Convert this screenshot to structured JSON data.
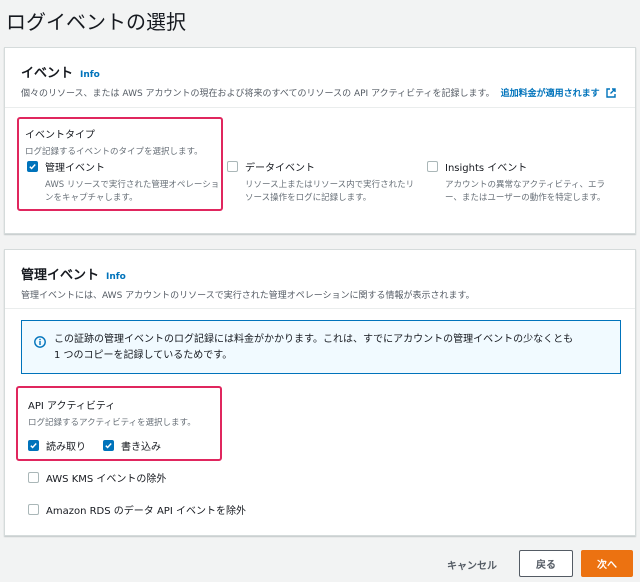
{
  "page": {
    "title": "ログイベントの選択"
  },
  "events_panel": {
    "title": "イベント",
    "info": "Info",
    "description": "個々のリソース、または AWS アカウントの現在および将来のすべてのリソースの API アクティビティを記録します。",
    "extra_charge_link": "追加料金が適用されます",
    "event_type": {
      "label": "イベントタイプ",
      "sublabel": "ログ記録するイベントのタイプを選択します。",
      "options": [
        {
          "label": "管理イベント",
          "checked": true,
          "desc_line1": "AWS リソースで実行された管理オペレーショ",
          "desc_line2": "ンをキャプチャします。"
        },
        {
          "label": "データイベント",
          "checked": false,
          "desc_line1": "リソース上またはリソース内で実行されたリ",
          "desc_line2": "ソース操作をログに記録します。"
        },
        {
          "label": "Insights イベント",
          "checked": false,
          "desc_line1": "アカウントの異常なアクティビティ、エラ",
          "desc_line2": "ー、またはユーザーの動作を特定します。"
        }
      ]
    }
  },
  "mgmt_panel": {
    "title": "管理イベント",
    "info": "Info",
    "description": "管理イベントには、AWS アカウントのリソースで実行された管理オペレーションに関する情報が表示されます。",
    "alert_line1": "この証跡の管理イベントのログ記録には料金がかかります。これは、すでにアカウントの管理イベントの少なくとも",
    "alert_line2": "1 つのコピーを記録しているためです。",
    "api_activity": {
      "label": "API アクティビティ",
      "sublabel": "ログ記録するアクティビティを選択します。",
      "read_label": "読み取り",
      "write_label": "書き込み"
    },
    "exclude_kms": "AWS KMS イベントの除外",
    "exclude_rds": "Amazon RDS のデータ API イベントを除外"
  },
  "footer": {
    "cancel": "キャンセル",
    "back": "戻る",
    "next": "次へ"
  },
  "colors": {
    "accent": "#0073bb",
    "highlight": "#e0265e",
    "primary_button": "#ec7211"
  }
}
